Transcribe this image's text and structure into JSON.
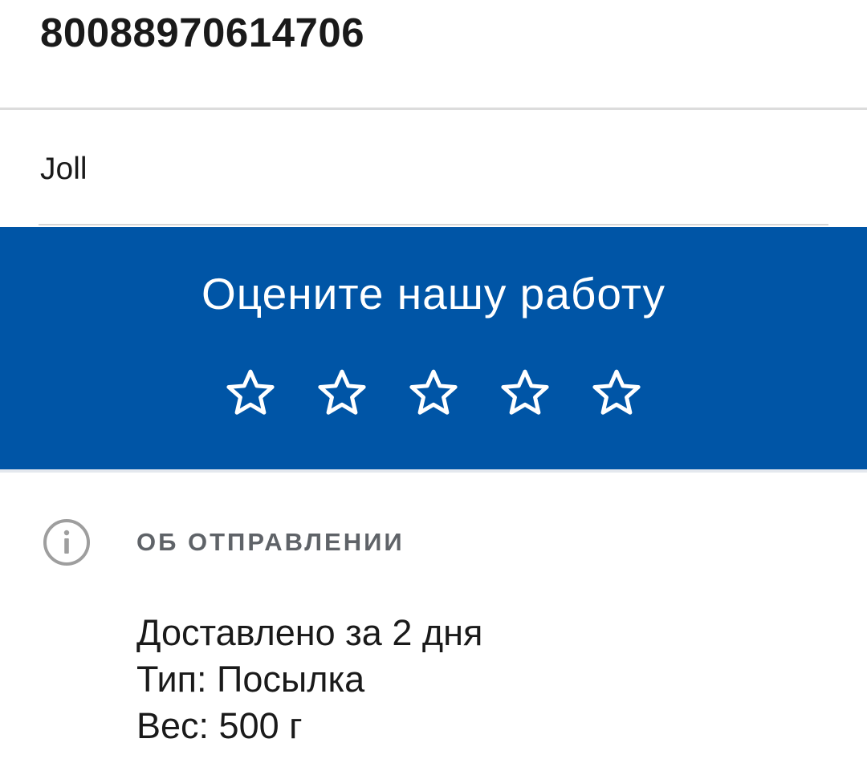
{
  "tracking": {
    "number": "80088970614706"
  },
  "sender": {
    "name": "Joll"
  },
  "rating": {
    "title": "Оцените нашу работу",
    "stars_total": 5,
    "stars_selected": 0,
    "star_icon": "star-outline-icon",
    "background_color": "#0055a6"
  },
  "shipment": {
    "section_icon": "info-icon",
    "section_title": "ОБ ОТПРАВЛЕНИИ",
    "delivered_text": "Доставлено за 2 дня",
    "type_text": "Тип: Посылка",
    "weight_text": "Вес: 500 г"
  }
}
